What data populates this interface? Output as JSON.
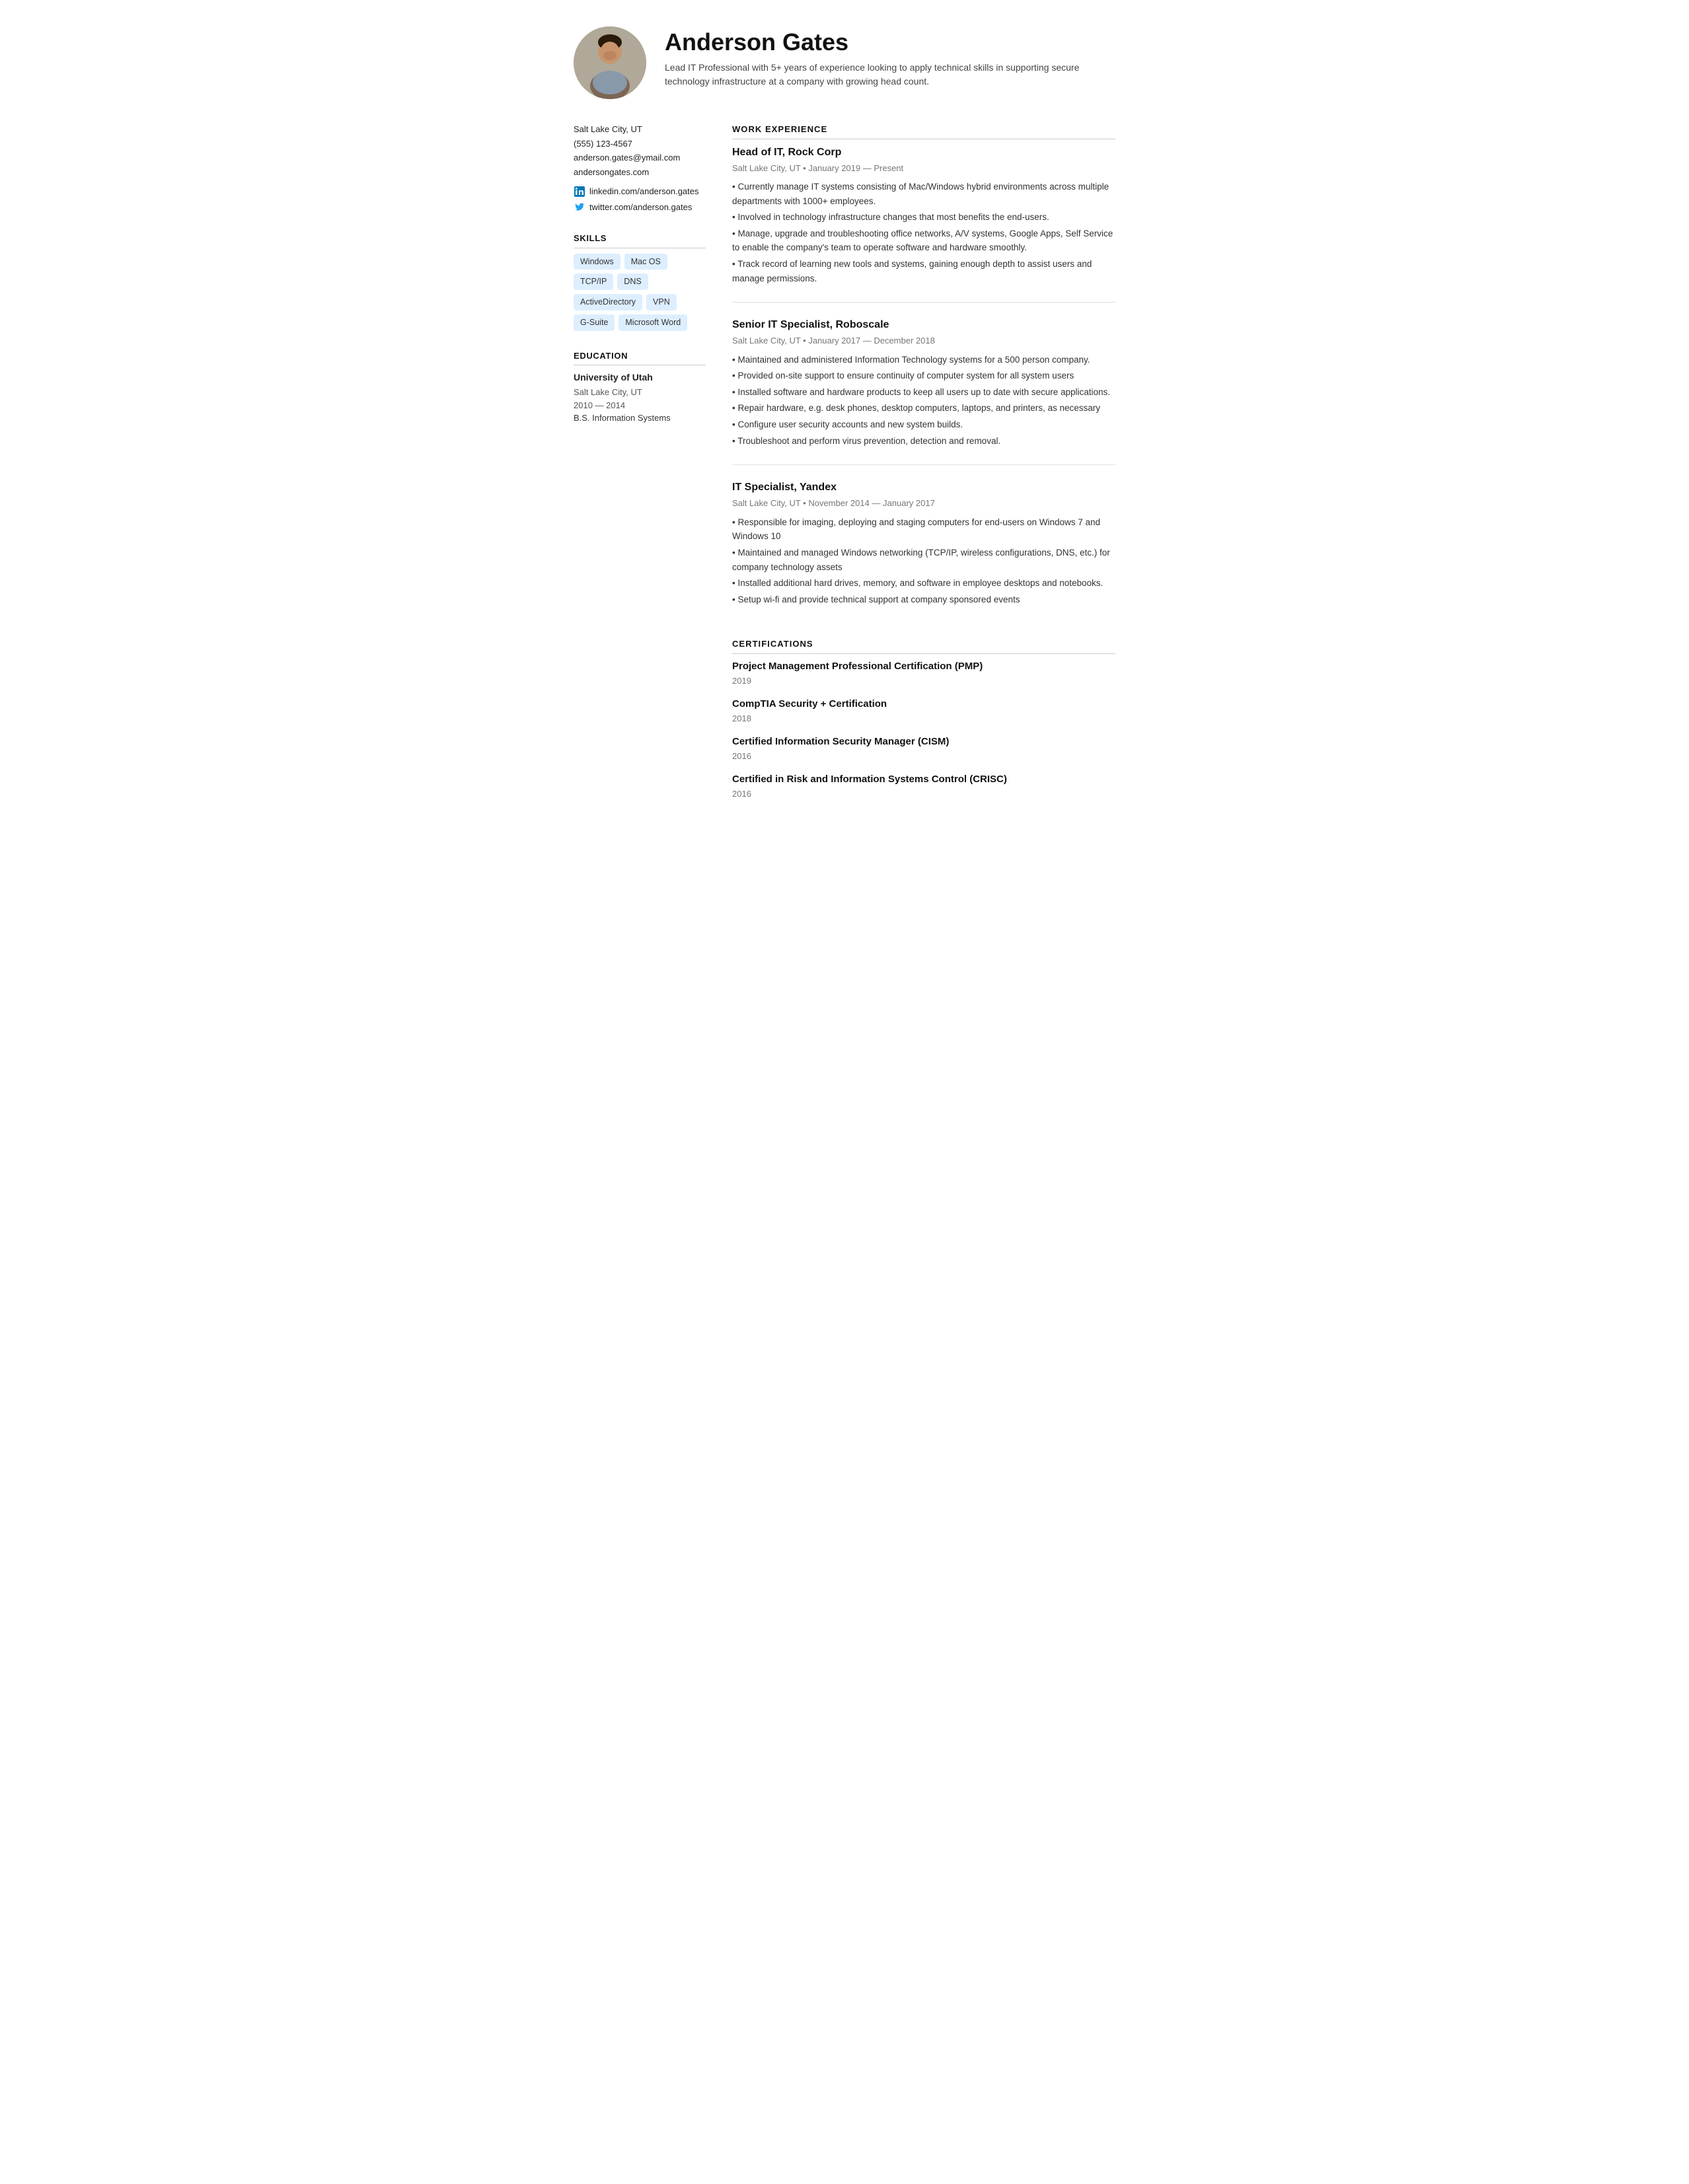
{
  "header": {
    "name": "Anderson Gates",
    "summary": "Lead IT Professional with 5+ years of experience looking to apply technical skills in supporting secure technology infrastructure at a company with growing head count."
  },
  "contact": {
    "location": "Salt Lake City, UT",
    "phone": "(555) 123-4567",
    "email": "anderson.gates@ymail.com",
    "website": "andersongates.com",
    "linkedin": "linkedin.com/anderson.gates",
    "twitter": "twitter.com/anderson.gates"
  },
  "skills": {
    "heading": "SKILLS",
    "items": [
      "Windows",
      "Mac OS",
      "TCP/IP",
      "DNS",
      "ActiveDirectory",
      "VPN",
      "G-Suite",
      "Microsoft Word"
    ]
  },
  "education": {
    "heading": "EDUCATION",
    "entries": [
      {
        "school": "University of Utah",
        "location": "Salt Lake City, UT",
        "years": "2010 — 2014",
        "degree": "B.S. Information Systems"
      }
    ]
  },
  "work_experience": {
    "heading": "WORK EXPERIENCE",
    "jobs": [
      {
        "title": "Head of IT, Rock Corp",
        "meta": "Salt Lake City, UT • January 2019 — Present",
        "bullets": [
          "• Currently manage IT systems consisting of Mac/Windows hybrid environments across multiple departments with 1000+ employees.",
          "• Involved in technology infrastructure changes that most benefits the end-users.",
          "• Manage, upgrade and troubleshooting office networks, A/V systems, Google Apps, Self Service to enable the company's team to operate software and hardware smoothly.",
          "• Track record of learning new tools and systems, gaining enough depth to assist users and manage permissions."
        ]
      },
      {
        "title": "Senior IT Specialist, Roboscale",
        "meta": "Salt Lake City, UT • January 2017 — December 2018",
        "bullets": [
          "• Maintained and administered Information Technology systems for a 500 person company.",
          "• Provided on-site support to ensure continuity of computer system for all system users",
          "• Installed software and hardware products to keep all users up to date with secure applications.",
          "• Repair hardware, e.g. desk phones, desktop computers, laptops, and printers, as necessary",
          "• Configure user security accounts and new system builds.",
          "• Troubleshoot and perform virus prevention, detection and removal."
        ]
      },
      {
        "title": "IT Specialist, Yandex",
        "meta": "Salt Lake City, UT • November 2014 — January 2017",
        "bullets": [
          "• Responsible for imaging, deploying and staging computers for end-users on Windows 7 and Windows 10",
          "• Maintained and managed Windows networking (TCP/IP, wireless configurations, DNS, etc.) for company technology assets",
          "• Installed additional hard drives, memory, and software in employee desktops and notebooks.",
          "• Setup wi-fi and provide technical support at company sponsored events"
        ]
      }
    ]
  },
  "certifications": {
    "heading": "CERTIFICATIONS",
    "items": [
      {
        "name": "Project Management Professional Certification (PMP)",
        "year": "2019"
      },
      {
        "name": "CompTIA Security + Certification",
        "year": "2018"
      },
      {
        "name": "Certified Information Security Manager (CISM)",
        "year": "2016"
      },
      {
        "name": "Certified in Risk and Information Systems Control (CRISC)",
        "year": "2016"
      }
    ]
  }
}
